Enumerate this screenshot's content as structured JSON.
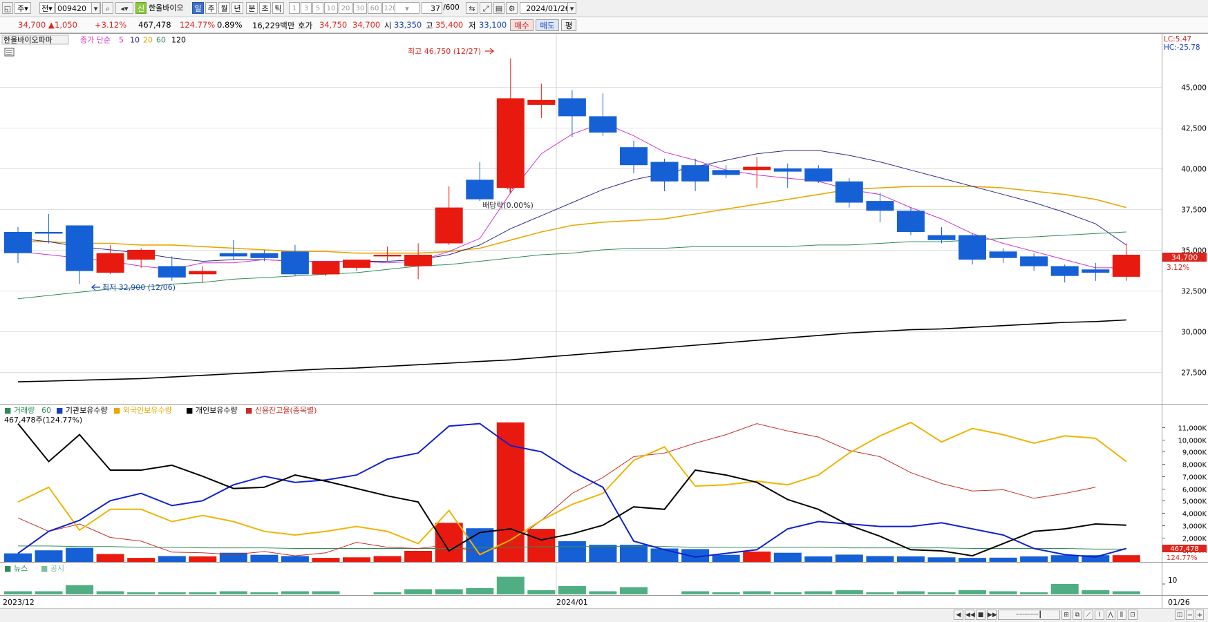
{
  "toolbar": {
    "market": "주",
    "type": "전",
    "code": "009420",
    "badge": "신",
    "name": "한올바이오",
    "periods": [
      "일",
      "주",
      "월",
      "년",
      "분",
      "초",
      "틱"
    ],
    "active_period": "일",
    "intervals": [
      "1",
      "3",
      "5",
      "10",
      "20",
      "30",
      "60",
      "120"
    ],
    "count": "37",
    "count_total": "/600",
    "date": "2024/01/26",
    "search_icon": "search-icon",
    "settings_icon": "gear-icon"
  },
  "info": {
    "price": "34,700",
    "change": "1,050",
    "change_pct": "+3.12%",
    "volume": "467,478",
    "volume_ratio": "124.77%",
    "turnover": "0.89%",
    "amount": "16,229백만",
    "quote_label": "호가",
    "ask": "34,750",
    "bid": "34,700",
    "open_label": "시",
    "open": "33,350",
    "high_label": "고",
    "high": "35,400",
    "low_label": "저",
    "low": "33,100",
    "buy_label": "매수",
    "sell_label": "매도",
    "eval_label": "평"
  },
  "chart_data": {
    "type": "candlestick",
    "price_legend": {
      "name": "한올바이오파마",
      "ma_label": "종가 단순",
      "periods": [
        "5",
        "10",
        "20",
        "60",
        "120"
      ],
      "colors": [
        "#cc33cc",
        "#2a2a8c",
        "#e8a800",
        "#2e8b57",
        "#000000"
      ]
    },
    "lc_label": "LC:5.47",
    "hc_label": "HC:-25.78",
    "y_ticks": [
      27500,
      30000,
      32500,
      35000,
      37500,
      40000,
      42500,
      45000
    ],
    "y_range": [
      25550,
      48300
    ],
    "last_price_label": "34,700",
    "last_pct_label": "3.12%",
    "high_annotation": "최고 46,750 (12/27)",
    "low_annotation": "최저 32,900 (12/06)",
    "dividend_annotation": "배당락(0.00%)",
    "x_labels": [
      "2023/12",
      "2024/01"
    ],
    "right_date_label": "01/26",
    "candles": [
      {
        "o": 36100,
        "h": 36400,
        "l": 34200,
        "c": 34800
      },
      {
        "o": 36100,
        "h": 37200,
        "l": 35400,
        "c": 36000
      },
      {
        "o": 36500,
        "h": 36500,
        "l": 32900,
        "c": 33700
      },
      {
        "o": 33600,
        "h": 35300,
        "l": 33500,
        "c": 34800
      },
      {
        "o": 34400,
        "h": 35100,
        "l": 33900,
        "c": 35000
      },
      {
        "o": 34000,
        "h": 34600,
        "l": 33100,
        "c": 33300
      },
      {
        "o": 33500,
        "h": 34000,
        "l": 33000,
        "c": 33700
      },
      {
        "o": 34800,
        "h": 35600,
        "l": 34400,
        "c": 34600
      },
      {
        "o": 34800,
        "h": 35000,
        "l": 34300,
        "c": 34500
      },
      {
        "o": 34900,
        "h": 35300,
        "l": 33400,
        "c": 33500
      },
      {
        "o": 33500,
        "h": 34300,
        "l": 33400,
        "c": 34300
      },
      {
        "o": 33900,
        "h": 34400,
        "l": 33700,
        "c": 34400
      },
      {
        "o": 34600,
        "h": 35200,
        "l": 34300,
        "c": 34700
      },
      {
        "o": 34000,
        "h": 35400,
        "l": 33200,
        "c": 34700
      },
      {
        "o": 35400,
        "h": 38900,
        "l": 35300,
        "c": 37600
      },
      {
        "o": 39300,
        "h": 40400,
        "l": 38000,
        "c": 38100
      },
      {
        "o": 38800,
        "h": 46750,
        "l": 38500,
        "c": 44300
      },
      {
        "o": 43900,
        "h": 45200,
        "l": 43100,
        "c": 44200
      },
      {
        "o": 44300,
        "h": 44800,
        "l": 41900,
        "c": 43200
      },
      {
        "o": 43200,
        "h": 44600,
        "l": 42000,
        "c": 42200
      },
      {
        "o": 41300,
        "h": 41700,
        "l": 39700,
        "c": 40200
      },
      {
        "o": 40400,
        "h": 40600,
        "l": 38600,
        "c": 39200
      },
      {
        "o": 40200,
        "h": 40600,
        "l": 38600,
        "c": 39200
      },
      {
        "o": 39900,
        "h": 40200,
        "l": 39400,
        "c": 39600
      },
      {
        "o": 39900,
        "h": 40700,
        "l": 38800,
        "c": 40100
      },
      {
        "o": 40000,
        "h": 40300,
        "l": 38800,
        "c": 39800
      },
      {
        "o": 40000,
        "h": 40200,
        "l": 39100,
        "c": 39200
      },
      {
        "o": 39200,
        "h": 39400,
        "l": 37600,
        "c": 37900
      },
      {
        "o": 38000,
        "h": 38500,
        "l": 36700,
        "c": 37400
      },
      {
        "o": 37400,
        "h": 37600,
        "l": 35900,
        "c": 36100
      },
      {
        "o": 35900,
        "h": 36400,
        "l": 35400,
        "c": 35600
      },
      {
        "o": 35900,
        "h": 36000,
        "l": 34100,
        "c": 34400
      },
      {
        "o": 34900,
        "h": 35100,
        "l": 34200,
        "c": 34500
      },
      {
        "o": 34600,
        "h": 34800,
        "l": 33700,
        "c": 34000
      },
      {
        "o": 34000,
        "h": 34100,
        "l": 33000,
        "c": 33400
      },
      {
        "o": 33800,
        "h": 34200,
        "l": 33100,
        "c": 33600
      },
      {
        "o": 33350,
        "h": 35400,
        "l": 33100,
        "c": 34700
      }
    ],
    "ma5": [
      34900,
      34700,
      34500,
      34300,
      34000,
      33800,
      34200,
      34200,
      34400,
      34300,
      34300,
      34300,
      34200,
      34300,
      34900,
      35700,
      38500,
      40900,
      42100,
      42800,
      42000,
      41000,
      40500,
      39900,
      39600,
      39400,
      39200,
      38700,
      38400,
      37600,
      36900,
      36000,
      35400,
      34900,
      34400,
      33900,
      33900
    ],
    "ma10": [
      35700,
      35500,
      35200,
      35000,
      34800,
      34500,
      34300,
      34400,
      34400,
      34300,
      34300,
      34300,
      34300,
      34400,
      34700,
      35300,
      36300,
      37100,
      37900,
      38700,
      39300,
      39700,
      40100,
      40500,
      40900,
      41100,
      41100,
      40800,
      40400,
      39900,
      39400,
      38900,
      38400,
      37900,
      37300,
      36600,
      35300
    ],
    "ma20": [
      35500,
      35500,
      35400,
      35400,
      35300,
      35300,
      35200,
      35100,
      35000,
      34900,
      34900,
      34800,
      34800,
      34800,
      34900,
      35100,
      35600,
      36100,
      36500,
      36700,
      36800,
      36900,
      37200,
      37500,
      37800,
      38100,
      38400,
      38700,
      38800,
      38900,
      38900,
      38900,
      38800,
      38600,
      38400,
      38100,
      37600
    ],
    "ma60": [
      32000,
      32200,
      32400,
      32600,
      32700,
      32900,
      33000,
      33200,
      33300,
      33400,
      33500,
      33600,
      33800,
      34000,
      34100,
      34300,
      34500,
      34700,
      34800,
      35000,
      35100,
      35100,
      35200,
      35200,
      35200,
      35200,
      35300,
      35300,
      35400,
      35500,
      35500,
      35600,
      35700,
      35800,
      35900,
      36000,
      36100
    ],
    "ma120": [
      26900,
      26950,
      27000,
      27050,
      27100,
      27200,
      27300,
      27400,
      27500,
      27600,
      27700,
      27750,
      27850,
      27950,
      28050,
      28150,
      28250,
      28400,
      28550,
      28700,
      28850,
      29000,
      29150,
      29300,
      29450,
      29600,
      29750,
      29900,
      30000,
      30100,
      30150,
      30250,
      30350,
      30450,
      30550,
      30600,
      30700
    ],
    "volume_panel": {
      "legend": [
        "거래량",
        "60",
        "기관보유수량",
        "외국인보유수량",
        "개인보유수량",
        "신용잔고율(종목별)"
      ],
      "legend_colors": [
        "#2e8b57",
        "#2e8b57",
        "#1a3fb0",
        "#e8a800",
        "#000000",
        "#c0302b"
      ],
      "current_label": "467,478주(124.77%)",
      "y_ticks": [
        1000,
        2000,
        3000,
        4000,
        5000,
        6000,
        7000,
        8000,
        9000,
        10000,
        11000
      ],
      "y_tick_labels": [
        "1,000K",
        "2,000K",
        "3,000K",
        "4,000K",
        "5,000K",
        "6,000K",
        "7,000K",
        "8,000K",
        "9,000K",
        "10,000K",
        "11,000K"
      ],
      "y_range": [
        0,
        11900
      ],
      "last_volume_label": "467,478",
      "last_pct_label": "124.77%",
      "volume": [
        700,
        950,
        1150,
        650,
        330,
        480,
        450,
        750,
        580,
        480,
        330,
        380,
        480,
        900,
        3200,
        2750,
        11400,
        2700,
        1700,
        1400,
        1400,
        1100,
        1050,
        580,
        850,
        750,
        450,
        600,
        480,
        450,
        380,
        330,
        350,
        450,
        550,
        550,
        550
      ],
      "vol_ma60": [
        1300,
        1300,
        1250,
        1250,
        1200,
        1200,
        1150,
        1150,
        1150,
        1100,
        1100,
        1100,
        1100,
        1100,
        1100,
        1150,
        1200,
        1250,
        1250,
        1250,
        1250,
        1250,
        1200,
        1200,
        1200,
        1200,
        1200,
        1150,
        1150,
        1150,
        1150,
        1100,
        1100,
        1100,
        1100,
        1050,
        1050
      ],
      "institution": [
        700,
        2500,
        3400,
        5000,
        5600,
        4600,
        5000,
        6300,
        7000,
        6500,
        6700,
        7100,
        8400,
        8900,
        11100,
        11300,
        9500,
        9000,
        7400,
        6100,
        1700,
        1000,
        400,
        700,
        1000,
        2700,
        3300,
        3100,
        2900,
        2900,
        3200,
        2700,
        2200,
        1100,
        600,
        400,
        1100
      ],
      "foreign": [
        4900,
        6100,
        2600,
        4300,
        4300,
        3300,
        3800,
        3300,
        2500,
        2200,
        2500,
        2900,
        2500,
        1500,
        4200,
        600,
        1800,
        3400,
        4700,
        5600,
        8300,
        9400,
        6200,
        6300,
        6600,
        6300,
        7100,
        8900,
        10300,
        11400,
        9800,
        10900,
        10400,
        9700,
        10300,
        10100,
        8200
      ],
      "individual": [
        11300,
        8200,
        10400,
        7500,
        7500,
        7900,
        7000,
        6000,
        6100,
        7100,
        6600,
        6000,
        5400,
        4900,
        900,
        2400,
        2700,
        1800,
        2300,
        3000,
        4500,
        4300,
        7500,
        7100,
        6500,
        5100,
        4300,
        3000,
        2100,
        1000,
        900,
        500,
        1500,
        2500,
        2700,
        3100,
        3000
      ],
      "credit": [
        3600,
        2500,
        3100,
        2000,
        1700,
        800,
        750,
        600,
        850,
        500,
        750,
        1600,
        1200,
        1100,
        1400,
        700,
        1500,
        3400,
        5600,
        6900,
        8600,
        8900,
        9700,
        10400,
        11300,
        10700,
        10200,
        9100,
        8600,
        7300,
        6400,
        5800,
        5900,
        5200,
        5600,
        6100,
        null
      ]
    },
    "news_panel": {
      "legend": [
        "뉴스",
        "공시"
      ],
      "legend_colors": [
        "#2e8b57",
        "#2e8b57"
      ],
      "y_tick": "10",
      "y_range": [
        0,
        18
      ],
      "news": [
        3,
        3,
        9,
        3,
        2,
        2,
        2,
        3,
        2,
        3,
        3,
        0,
        2,
        5,
        5,
        6,
        17,
        4,
        8,
        3,
        7,
        0,
        3,
        2,
        3,
        2,
        3,
        4,
        2,
        3,
        2,
        4,
        3,
        2,
        10,
        4,
        3
      ],
      "disclosure": [
        0,
        0,
        0,
        0,
        0,
        0,
        0,
        0,
        0,
        0,
        0,
        0,
        0,
        0,
        0,
        0,
        0,
        0,
        0,
        0,
        0,
        0,
        0,
        0,
        0,
        0,
        0,
        0,
        0,
        0,
        0,
        0,
        0,
        0,
        0,
        0,
        0
      ]
    }
  }
}
